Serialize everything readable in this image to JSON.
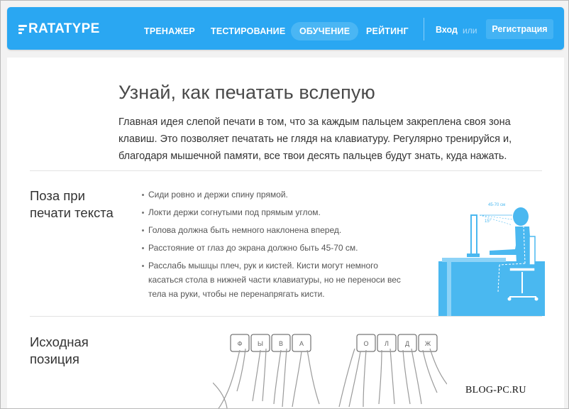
{
  "header": {
    "logo_text": "RATATYPE",
    "nav": [
      "ТРЕНАЖЕР",
      "ТЕСТИРОВАНИЕ",
      "ОБУЧЕНИЕ",
      "РЕЙТИНГ"
    ],
    "active_nav": "ОБУЧЕНИЕ",
    "login": "Вход",
    "or": "или",
    "register": "Регистрация",
    "colors": {
      "bar": "#2aa7f2",
      "active_pill": "#4ab6f4"
    }
  },
  "main": {
    "title": "Узнай, как печатать вслепую",
    "intro": "Главная идея слепой печати в том, что за каждым пальцем закреплена своя зона клавиш. Это позволяет печатать не глядя на клавиатуру. Регулярно тренируйся и, благодаря мышечной памяти, все твои десять пальцев будут знать, куда нажать."
  },
  "posture_section": {
    "title_line1": "Поза при",
    "title_line2": "печати текста",
    "tips": [
      "Сиди ровно и держи спину прямой.",
      "Локти держи согнутыми под прямым углом.",
      "Голова должна быть немного наклонена вперед.",
      "Расстояние от глаз до экрана должно быть 45-70 см.",
      "Расслабь мышцы плеч, рук и кистей. Кисти могут немного касаться стола в нижней части клавиатуры, но не переноси вес тела на руки, чтобы не перенапрягать кисти."
    ],
    "illustration": {
      "distance_label": "45-70 см",
      "angle_label": "15°",
      "color": "#4ab8f0"
    }
  },
  "home_section": {
    "title_line1": "Исходная",
    "title_line2": "позиция",
    "left_keys": [
      "Ф",
      "Ы",
      "В",
      "А"
    ],
    "right_keys": [
      "О",
      "Л",
      "Д",
      "Ж"
    ]
  },
  "watermark": "BLOG-PC.RU"
}
